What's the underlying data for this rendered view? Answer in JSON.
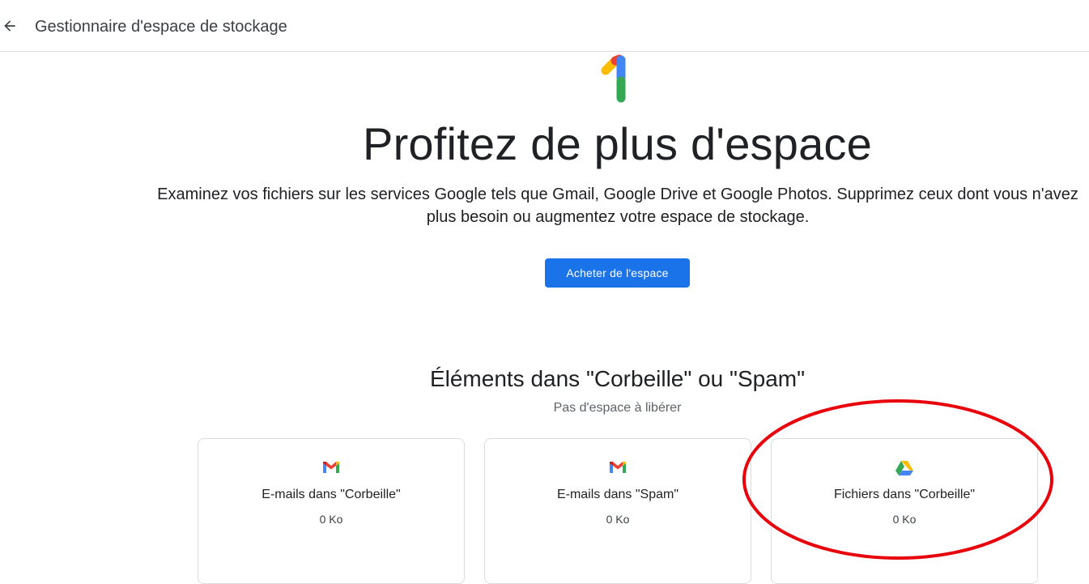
{
  "header": {
    "back_icon": "arrow-back-icon",
    "title": "Gestionnaire d'espace de stockage"
  },
  "logo": {
    "icon": "google-one-logo",
    "colors": [
      "#fbbc04",
      "#ea4335",
      "#4285f4",
      "#34a853"
    ]
  },
  "hero": {
    "title": "Profitez de plus d'espace",
    "description": "Examinez vos fichiers sur les services Google tels que Gmail, Google Drive et Google Photos. Supprimez ceux dont vous n'avez plus besoin ou augmentez votre espace de stockage.",
    "buy_button": "Acheter de l'espace"
  },
  "trash_section": {
    "title": "Éléments dans \"Corbeille\" ou \"Spam\"",
    "subtitle": "Pas d'espace à libérer",
    "cards": [
      {
        "icon": "gmail-icon",
        "title": "E-mails dans \"Corbeille\"",
        "size": "0 Ko"
      },
      {
        "icon": "gmail-icon",
        "title": "E-mails dans \"Spam\"",
        "size": "0 Ko"
      },
      {
        "icon": "google-drive-icon",
        "title": "Fichiers dans \"Corbeille\"",
        "size": "0 Ko"
      }
    ]
  },
  "colors": {
    "primary_button": "#1a73e8",
    "annotation_circle": "#e8000b",
    "divider": "#dadce0"
  }
}
